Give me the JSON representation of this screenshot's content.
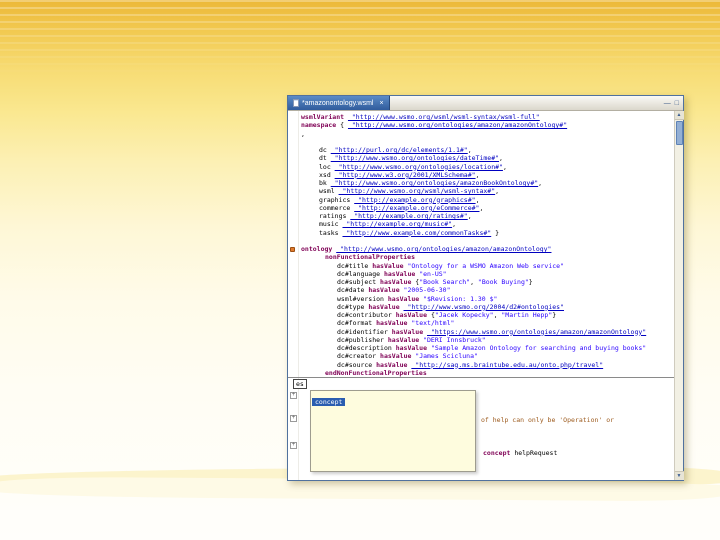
{
  "colors": {
    "keyword": "#7F0055",
    "iri": "#0000C0",
    "string": "#2A00FF",
    "fragment": "#9C5A1D",
    "tab": "#5B8BC7"
  },
  "icons": {
    "fold_plus": "+",
    "arrow_up": "▲",
    "arrow_down": "▼"
  },
  "window": {
    "tab_title": "*amazonontology.wsml",
    "close_glyph": "×",
    "minimize_glyph": "—",
    "maximize_glyph": "□"
  },
  "editor": {
    "lines": [
      {
        "ind": 0,
        "segs": [
          [
            "kw",
            "wsmlVariant "
          ],
          [
            "iri",
            "_\"http://www.wsmo.org/wsml/wsml-syntax/wsml-full\""
          ]
        ]
      },
      {
        "ind": 0,
        "segs": [
          [
            "kw",
            "namespace "
          ],
          [
            "plain",
            "{ "
          ],
          [
            "iri",
            "_\"http://www.wsmo.org/ontologies/amazon/amazonOntology#\""
          ]
        ]
      },
      {
        "ind": 0,
        "segs": [
          [
            "plain",
            ","
          ]
        ]
      },
      {
        "ind": 0,
        "segs": []
      },
      {
        "ind": 3,
        "segs": [
          [
            "plain",
            "dc "
          ],
          [
            "iri",
            "_\"http://purl.org/dc/elements/1.1#\""
          ],
          [
            "plain",
            ","
          ]
        ]
      },
      {
        "ind": 3,
        "segs": [
          [
            "plain",
            "dt "
          ],
          [
            "iri",
            "_\"http://www.wsmo.org/ontologies/dateTime#\""
          ],
          [
            "plain",
            ","
          ]
        ]
      },
      {
        "ind": 3,
        "segs": [
          [
            "plain",
            "loc "
          ],
          [
            "iri",
            "_\"http://www.wsmo.org/ontologies/location#\""
          ],
          [
            "plain",
            ","
          ]
        ]
      },
      {
        "ind": 3,
        "segs": [
          [
            "plain",
            "xsd "
          ],
          [
            "iri",
            "_\"http://www.w3.org/2001/XMLSchema#\""
          ],
          [
            "plain",
            ","
          ]
        ]
      },
      {
        "ind": 3,
        "segs": [
          [
            "plain",
            "bk "
          ],
          [
            "iri",
            "_\"http://www.wsmo.org/ontologies/amazonBookOntology#\""
          ],
          [
            "plain",
            ","
          ]
        ]
      },
      {
        "ind": 3,
        "segs": [
          [
            "plain",
            "wsml "
          ],
          [
            "iri",
            "_\"http://www.wsmo.org/wsml/wsml-syntax#\""
          ],
          [
            "plain",
            ","
          ]
        ]
      },
      {
        "ind": 3,
        "segs": [
          [
            "plain",
            "graphics "
          ],
          [
            "iri",
            "_\"http://example.org/graphics#\""
          ],
          [
            "plain",
            ","
          ]
        ]
      },
      {
        "ind": 3,
        "segs": [
          [
            "plain",
            "commerce "
          ],
          [
            "iri",
            "_\"http://example.org/eCommerce#\""
          ],
          [
            "plain",
            ","
          ]
        ]
      },
      {
        "ind": 3,
        "segs": [
          [
            "plain",
            "ratings "
          ],
          [
            "iri",
            "_\"http://example.org/ratings#\""
          ],
          [
            "plain",
            ","
          ]
        ]
      },
      {
        "ind": 3,
        "segs": [
          [
            "plain",
            "music "
          ],
          [
            "iri",
            "_\"http://example.org/music#\""
          ],
          [
            "plain",
            ","
          ]
        ]
      },
      {
        "ind": 3,
        "segs": [
          [
            "plain",
            "tasks "
          ],
          [
            "iri",
            "_\"http://www.example.com/commonTasks#\""
          ],
          [
            "plain",
            " }"
          ]
        ]
      },
      {
        "ind": 0,
        "segs": []
      },
      {
        "ind": 0,
        "segs": [
          [
            "kw",
            "ontology "
          ],
          [
            "iri",
            "_\"http://www.wsmo.org/ontologies/amazon/amazonOntology\""
          ]
        ]
      },
      {
        "ind": 4,
        "segs": [
          [
            "kw",
            "nonFunctionalProperties"
          ]
        ]
      },
      {
        "ind": 6,
        "segs": [
          [
            "plain",
            "dc#title "
          ],
          [
            "kw",
            "hasValue "
          ],
          [
            "str",
            "\"Ontology for a WSMO Amazon Web service\""
          ]
        ]
      },
      {
        "ind": 6,
        "segs": [
          [
            "plain",
            "dc#language "
          ],
          [
            "kw",
            "hasValue "
          ],
          [
            "str",
            "\"en-US\""
          ]
        ]
      },
      {
        "ind": 6,
        "segs": [
          [
            "plain",
            "dc#subject "
          ],
          [
            "kw",
            "hasValue "
          ],
          [
            "plain",
            "{"
          ],
          [
            "str",
            "\"Book Search\""
          ],
          [
            "plain",
            ", "
          ],
          [
            "str",
            "\"Book Buying\""
          ],
          [
            "plain",
            "}"
          ]
        ]
      },
      {
        "ind": 6,
        "segs": [
          [
            "plain",
            "dc#date "
          ],
          [
            "kw",
            "hasValue "
          ],
          [
            "str",
            "\"2005-06-30\""
          ]
        ]
      },
      {
        "ind": 6,
        "segs": [
          [
            "plain",
            "wsml#version "
          ],
          [
            "kw",
            "hasValue "
          ],
          [
            "str",
            "\"$Revision: 1.30 $\""
          ]
        ]
      },
      {
        "ind": 6,
        "segs": [
          [
            "plain",
            "dc#type "
          ],
          [
            "kw",
            "hasValue "
          ],
          [
            "iri",
            "_\"http://www.wsmo.org/2004/d2#ontologies\""
          ]
        ]
      },
      {
        "ind": 6,
        "segs": [
          [
            "plain",
            "dc#contributor "
          ],
          [
            "kw",
            "hasValue "
          ],
          [
            "plain",
            "{"
          ],
          [
            "str",
            "\"Jacek Kopecky\""
          ],
          [
            "plain",
            ", "
          ],
          [
            "str",
            "\"Martin Hepp\""
          ],
          [
            "plain",
            "}"
          ]
        ]
      },
      {
        "ind": 6,
        "segs": [
          [
            "plain",
            "dc#format "
          ],
          [
            "kw",
            "hasValue "
          ],
          [
            "str",
            "\"text/html\""
          ]
        ]
      },
      {
        "ind": 6,
        "segs": [
          [
            "plain",
            "dc#identifier "
          ],
          [
            "kw",
            "hasValue "
          ],
          [
            "iri",
            "_\"https://www.wsmo.org/ontologies/amazon/amazonOntology\""
          ]
        ]
      },
      {
        "ind": 6,
        "segs": [
          [
            "plain",
            "dc#publisher "
          ],
          [
            "kw",
            "hasValue "
          ],
          [
            "str",
            "\"DERI Innsbruck\""
          ]
        ]
      },
      {
        "ind": 6,
        "segs": [
          [
            "plain",
            "dc#description "
          ],
          [
            "kw",
            "hasValue "
          ],
          [
            "str",
            "\"Sample Amazon Ontology for searching and buying books\""
          ]
        ]
      },
      {
        "ind": 6,
        "segs": [
          [
            "plain",
            "dc#creator "
          ],
          [
            "kw",
            "hasValue "
          ],
          [
            "str",
            "\"James Scicluna\""
          ]
        ]
      },
      {
        "ind": 6,
        "segs": [
          [
            "plain",
            "dc#source "
          ],
          [
            "kw",
            "hasValue "
          ],
          [
            "iri",
            "_\"http://sag.ms.braintube.edu.au/onto.php/travel\""
          ]
        ]
      },
      {
        "ind": 4,
        "segs": [
          [
            "kw",
            "endNonFunctionalProperties"
          ]
        ]
      }
    ]
  },
  "lower": {
    "typed_text": "es",
    "assist_selected": "concept",
    "comment_fragment": "of help can only be 'Operation' or",
    "declaration": {
      "ind": 0,
      "segs": [
        [
          "kw",
          "concept "
        ],
        [
          "plain",
          "helpRequest"
        ]
      ]
    }
  }
}
